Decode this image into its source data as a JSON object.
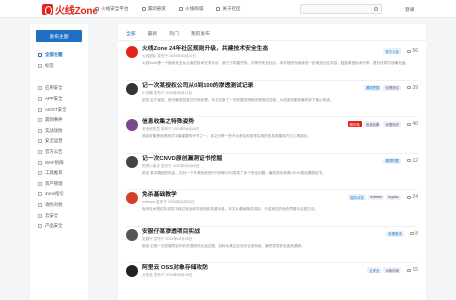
{
  "header": {
    "logo_text": "火线Zone",
    "nav": [
      "火线安全平台",
      "漏洞悬赏",
      "火线商城",
      "关于社区"
    ],
    "login": "登录"
  },
  "sidebar": {
    "publish": "发布主题",
    "items": [
      "全部主题",
      "标签",
      "应用安全",
      "APP安全",
      "AI/IOT安全",
      "漏洞事件",
      "实战攻防",
      "安全运营",
      "官方公告",
      "WAF防御",
      "工具推荐",
      "资产管理",
      "Zone指引",
      "攻防对抗",
      "云安全",
      "产品安全"
    ]
  },
  "tabs": [
    "全部",
    "最新",
    "热门",
    "我的发布"
  ],
  "colors": {
    "brand": "#e1251b",
    "accent": "#1d70c4"
  },
  "posts": [
    {
      "title": "火线Zone 24年社区规则升级，共建技术安全生态",
      "meta": "火线团队 发布于 2024年03月20日",
      "body": "火线Zone是一个面向安全从业者的技术交流平台，致力于构建开放、共享的安全社区。本次规则升级将进一步规范社区内容，鼓励原创技术分享，提升优质内容曝光度。",
      "tags": [
        "官方公告"
      ],
      "count": "56",
      "avatar_color": "#e1251b"
    },
    {
      "title": "记一次某授权公司从0到100的渗透测试记录",
      "meta": "小白帽 发布于 2024年06月11日",
      "body": "前言 由于保密，部分敏感信息已打码处理。本文记录了一次完整的授权渗透测试过程，从信息收集到最终拿下核心系统。",
      "tags": [
        "漏洞挖掘",
        "渗透测试"
      ],
      "count": "39",
      "avatar_color": "#333333"
    },
    {
      "title": "信息收集之特殊姿势",
      "meta": "安全研究员 发布于 2024年06月08日",
      "body": "信息收集是渗透测试中最重要的环节之一，本文分享一些不太常见但非常实用的信息收集技巧与工具组合。",
      "tags": [
        "精华帖",
        "信息收集",
        "渗透测试"
      ],
      "count": "40",
      "avatar_color": "#7a4a8c"
    },
    {
      "title": "记一次CNVD原创漏洞证书挖掘",
      "meta": "挖洞小能手 发布于 2024年06月05日",
      "body": "前言 某次偶然的机会，在对一个开源系统进行代码审计时发现了多个安全问题，最终成功获得CNVD原创漏洞证书。",
      "tags": [
        "漏洞挖掘"
      ],
      "count": "12",
      "avatar_color": "#444444"
    },
    {
      "title": "免杀基础教学",
      "meta": "redteam 发布于 2024年06月02日",
      "body": "免杀技术是红队攻防中绕过安全软件检测的关键手段，本文从基础概念讲起，介绍常见的免杀思路与实践方法。",
      "tags": [
        "攻防对抗",
        "redteam",
        "bypass"
      ],
      "count": "24",
      "avatar_color": "#d6402a"
    },
    {
      "title": "安服仔某渗透项目实战",
      "meta": "安服仔 发布于 2024年05月29日",
      "body": "前言 记录一次安服项目中的渗透测试实战过程，目标为某企业对外业务系统，最终发现多处高危漏洞。",
      "tags": [
        "渗透测试"
      ],
      "count": "8",
      "avatar_color": "#555555"
    },
    {
      "title": "阿里云 OSS对象存储攻防",
      "meta": "云安全 发布于 2024年05月26日",
      "body": "",
      "tags": [
        "云安全",
        "对象存储"
      ],
      "count": "15",
      "avatar_color": "#222222"
    }
  ]
}
